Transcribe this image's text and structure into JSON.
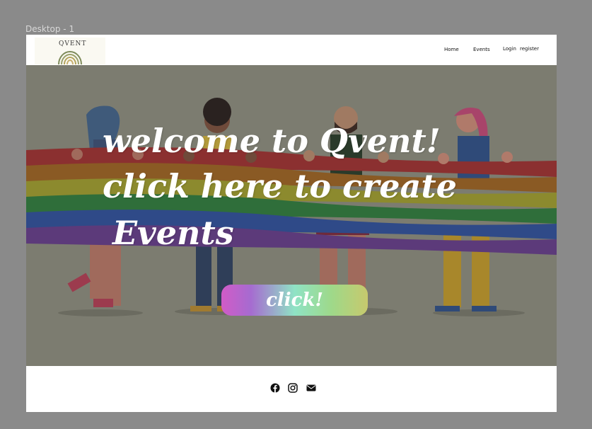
{
  "frame_label": "Desktop - 1",
  "logo": {
    "text": "QVENT"
  },
  "nav": {
    "home": "Home",
    "events": "Events",
    "login": "Login",
    "register": "register"
  },
  "hero": {
    "line1": "welcome to Qvent!",
    "line2": "click here to create",
    "line3": "Events",
    "cta_label": "click!"
  },
  "footer": {
    "icons": [
      "facebook-icon",
      "instagram-icon",
      "envelope-icon"
    ]
  },
  "colors": {
    "hero_overlay": "#7b7b6e",
    "page_bg": "#8a8a8a"
  }
}
